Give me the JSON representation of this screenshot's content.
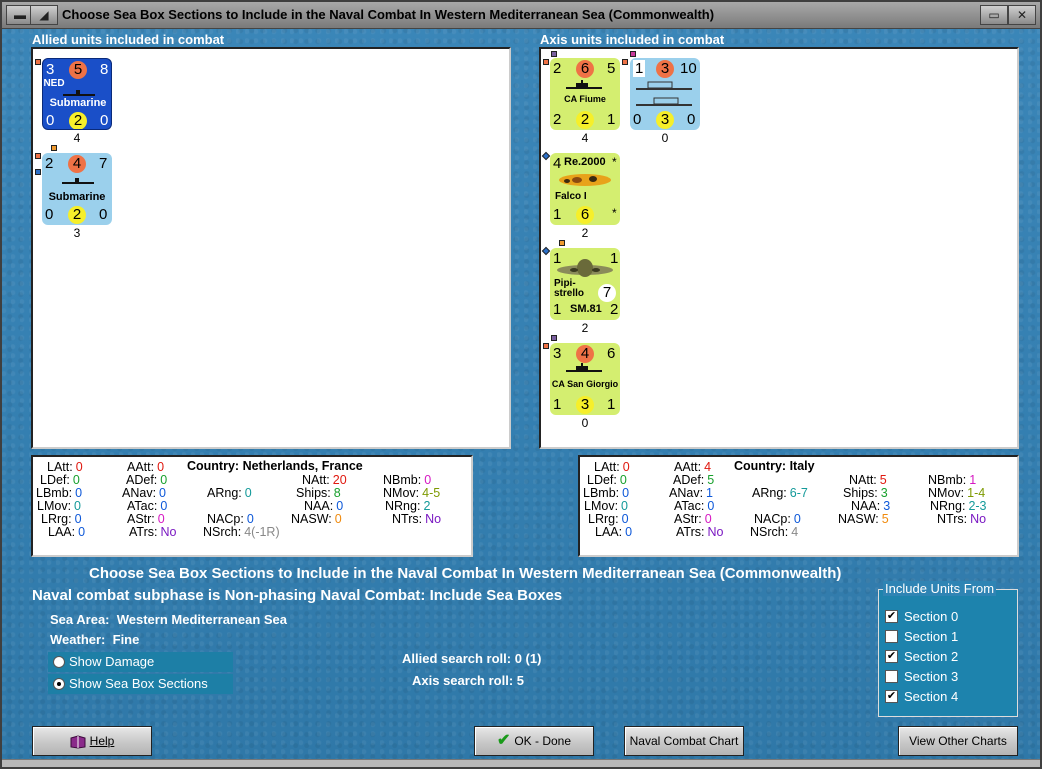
{
  "window": {
    "title": "Choose Sea Box Sections to Include in the Naval Combat In Western Mediterranean Sea (Commonwealth)",
    "left_buttons": [
      "▬",
      "◢"
    ],
    "right_buttons": [
      "▭",
      "✕"
    ]
  },
  "allied": {
    "label": "Allied units included in combat",
    "units": [
      {
        "top_left": "3",
        "top_mid": "5",
        "top_right": "8",
        "nation": "NED",
        "name": "Submarine",
        "bot_left": "0",
        "bot_mid": "2",
        "bot_right": "0",
        "below": "4",
        "color": "#1a4fc8"
      },
      {
        "top_left": "2",
        "top_mid": "4",
        "top_right": "7",
        "name": "Submarine",
        "bot_left": "0",
        "bot_mid": "2",
        "bot_right": "0",
        "below": "3",
        "color": "#9bd0ec"
      }
    ]
  },
  "axis": {
    "label": "Axis units included in combat",
    "units": [
      {
        "top_left": "2",
        "top_mid": "6",
        "top_right": "5",
        "name": "CA Fiume",
        "bot_left": "2",
        "bot_mid": "2",
        "bot_right": "1",
        "below": "4",
        "color": "#d4ee70"
      },
      {
        "top_left": "1",
        "top_mid": "3",
        "top_right": "10",
        "bot_left": "0",
        "bot_mid": "3",
        "bot_right": "0",
        "below": "0",
        "color": "#9bd0ec"
      },
      {
        "top_left": "4",
        "title": "Re.2000",
        "star": "*",
        "name": "Falco I",
        "bot_left": "1",
        "bot_mid": "6",
        "bot_right": "*",
        "below": "2",
        "color": "#d4ee70"
      },
      {
        "top_left": "1",
        "top_right": "1",
        "name1": "Pipi-",
        "name2": "strello",
        "mid_val": "7",
        "sub": "SM.81",
        "bot_left": "1",
        "bot_right": "2",
        "below": "2",
        "color": "#d4ee70"
      },
      {
        "top_left": "3",
        "top_mid": "4",
        "top_right": "6",
        "name": "CA San Giorgio",
        "bot_left": "1",
        "bot_mid": "3",
        "bot_right": "1",
        "below": "0",
        "color": "#d4ee70"
      }
    ]
  },
  "allied_stats": {
    "latt": "0",
    "ldef": "0",
    "lbmb": "0",
    "lmov": "0",
    "lrrg": "0",
    "laa": "0",
    "aatt": "0",
    "adef": "0",
    "anav": "0",
    "atac": "0",
    "astr": "0",
    "atrs": "No",
    "country_label": "Country:",
    "country": "Netherlands, France",
    "arng": "0",
    "natt": "20",
    "ships": "8",
    "naa": "0",
    "nasw": "0",
    "nacp": "0",
    "nsrch": "4(-1R)",
    "nbmb": "0",
    "nmov": "4-5",
    "nrng": "2",
    "ntrs": "No"
  },
  "axis_stats": {
    "latt": "0",
    "ldef": "0",
    "lbmb": "0",
    "lmov": "0",
    "lrrg": "0",
    "laa": "0",
    "aatt": "4",
    "adef": "5",
    "anav": "1",
    "atac": "0",
    "astr": "0",
    "atrs": "No",
    "country_label": "Country:",
    "country": "Italy",
    "arng": "6-7",
    "natt": "5",
    "ships": "3",
    "naa": "3",
    "nasw": "5",
    "nacp": "0",
    "nsrch": "4",
    "nbmb": "1",
    "nmov": "1-4",
    "nrng": "2-3",
    "ntrs": "No"
  },
  "labels": {
    "latt": "LAtt:",
    "ldef": "LDef:",
    "lbmb": "LBmb:",
    "lmov": "LMov:",
    "lrrg": "LRrg:",
    "laa": "LAA:",
    "aatt": "AAtt:",
    "adef": "ADef:",
    "anav": "ANav:",
    "atac": "ATac:",
    "astr": "AStr:",
    "atrs": "ATrs:",
    "arng": "ARng:",
    "natt": "NAtt:",
    "ships": "Ships:",
    "naa": "NAA:",
    "nasw": "NASW:",
    "nacp": "NACp:",
    "nsrch": "NSrch:",
    "nbmb": "NBmb:",
    "nmov": "NMov:",
    "nrng": "NRng:",
    "ntrs": "NTrs:"
  },
  "info": {
    "heading": "Choose Sea Box Sections to Include in the Naval Combat In Western Mediterranean Sea (Commonwealth)",
    "subphase": "Naval combat subphase is Non-phasing Naval Combat: Include Sea Boxes",
    "sea_area_label": "Sea Area:",
    "sea_area": "Western Mediterranean Sea",
    "weather_label": "Weather:",
    "weather": "Fine",
    "allied_roll_label": "Allied search roll:",
    "allied_roll": "0 (1)",
    "axis_roll_label": "Axis search roll:",
    "axis_roll": "5"
  },
  "view_options": [
    {
      "label": "Show Damage",
      "selected": false
    },
    {
      "label": "Show Sea Box Sections",
      "selected": true
    }
  ],
  "include_group": {
    "title": "Include Units From",
    "sections": [
      {
        "label": "Section 0",
        "checked": true
      },
      {
        "label": "Section 1",
        "checked": false
      },
      {
        "label": "Section 2",
        "checked": true
      },
      {
        "label": "Section 3",
        "checked": false
      },
      {
        "label": "Section 4",
        "checked": true
      }
    ]
  },
  "buttons": {
    "help": "Help",
    "ok": "OK - Done",
    "naval_chart": "Naval Combat Chart",
    "view_charts": "View Other Charts"
  },
  "check_mark": "✔"
}
